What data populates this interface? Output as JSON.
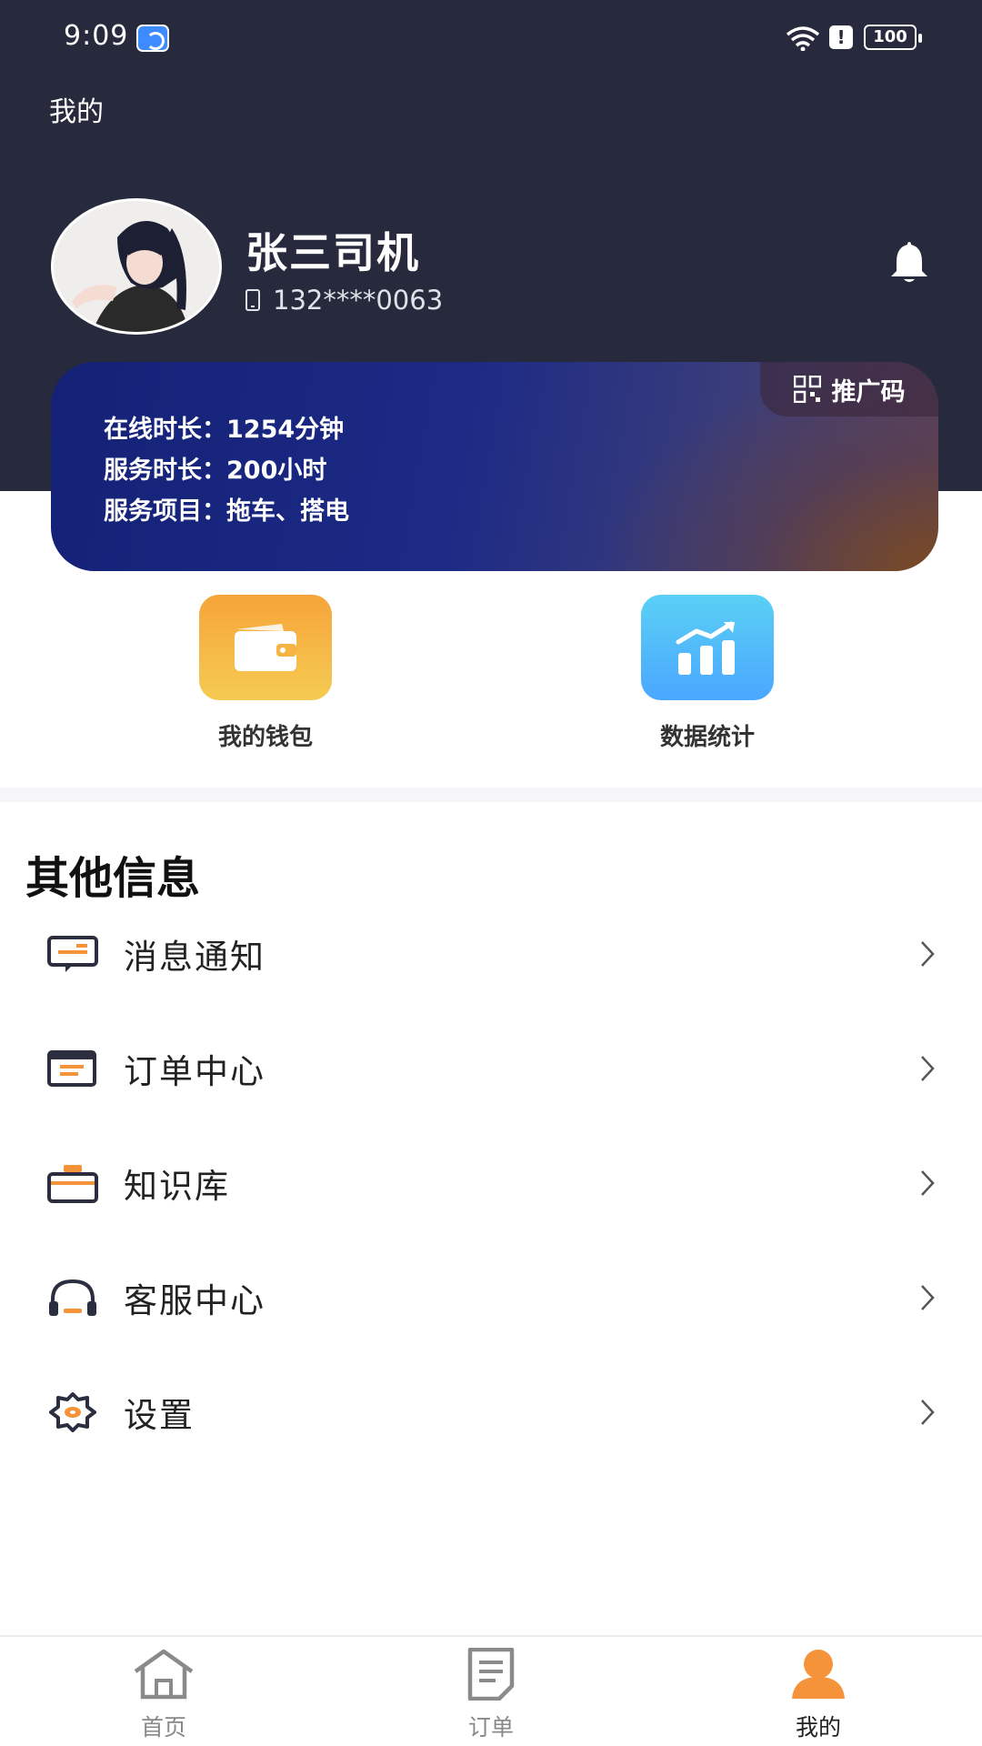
{
  "status_bar": {
    "time": "9:09",
    "battery": "100"
  },
  "page": {
    "title": "我的"
  },
  "profile": {
    "name": "张三司机",
    "phone": "132****0063"
  },
  "info_card": {
    "promo_label": "推广码",
    "online_duration": "在线时长：1254分钟",
    "service_duration": "服务时长：200小时",
    "service_items": "服务项目：拖车、搭电"
  },
  "quick_actions": [
    {
      "label": "我的钱包",
      "icon": "wallet-icon"
    },
    {
      "label": "数据统计",
      "icon": "bar-chart-icon"
    }
  ],
  "other_info": {
    "title": "其他信息",
    "items": [
      {
        "label": "消息通知",
        "icon": "message-icon"
      },
      {
        "label": "订单中心",
        "icon": "order-icon"
      },
      {
        "label": "知识库",
        "icon": "briefcase-icon"
      },
      {
        "label": "客服中心",
        "icon": "headset-icon"
      },
      {
        "label": "设置",
        "icon": "settings-icon"
      }
    ]
  },
  "tab_bar": {
    "tabs": [
      {
        "label": "首页",
        "icon": "home-icon"
      },
      {
        "label": "订单",
        "icon": "document-icon"
      },
      {
        "label": "我的",
        "icon": "user-icon"
      }
    ],
    "active_index": 2,
    "active_color": "#f5933a"
  },
  "colors": {
    "header_bg": "#272a3d",
    "accent_orange": "#f5933a"
  }
}
